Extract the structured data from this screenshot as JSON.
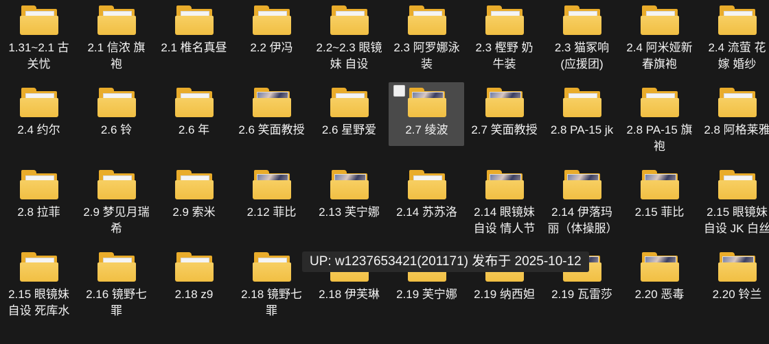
{
  "folders": [
    {
      "label": "1.31~2.1 古关忧",
      "thumb": false
    },
    {
      "label": "2.1 信浓 旗袍",
      "thumb": false
    },
    {
      "label": "2.1 椎名真昼",
      "thumb": false
    },
    {
      "label": "2.2 伊冯",
      "thumb": false
    },
    {
      "label": "2.2~2.3 眼镜妹 自设",
      "thumb": false
    },
    {
      "label": "2.3 阿罗娜泳装",
      "thumb": false
    },
    {
      "label": "2.3 樫野 奶牛装",
      "thumb": false
    },
    {
      "label": "2.3 猫冢响(应援团)",
      "thumb": false
    },
    {
      "label": "2.4 阿米娅新春旗袍",
      "thumb": false
    },
    {
      "label": "2.4 流萤 花嫁 婚纱",
      "thumb": false
    },
    {
      "label": "2.4 约尔",
      "thumb": false
    },
    {
      "label": "2.6 铃",
      "thumb": false
    },
    {
      "label": "2.6 年",
      "thumb": false
    },
    {
      "label": "2.6 笑面教授",
      "thumb": true
    },
    {
      "label": "2.6 星野爱",
      "thumb": false
    },
    {
      "label": "2.7 绫波",
      "thumb": true,
      "selected": true
    },
    {
      "label": "2.7 笑面教授",
      "thumb": true
    },
    {
      "label": "2.8 PA-15 jk",
      "thumb": false
    },
    {
      "label": "2.8 PA-15 旗袍",
      "thumb": false
    },
    {
      "label": "2.8 阿格莱雅",
      "thumb": false
    },
    {
      "label": "2.8 拉菲",
      "thumb": false
    },
    {
      "label": "2.9 梦见月瑞希",
      "thumb": false
    },
    {
      "label": "2.9 索米",
      "thumb": false
    },
    {
      "label": "2.12 菲比",
      "thumb": true
    },
    {
      "label": "2.13 芙宁娜",
      "thumb": true
    },
    {
      "label": "2.14 苏苏洛",
      "thumb": false
    },
    {
      "label": "2.14 眼镜妹 自设 情人节",
      "thumb": true
    },
    {
      "label": "2.14 伊落玛丽（体操服）",
      "thumb": true
    },
    {
      "label": "2.15 菲比",
      "thumb": true
    },
    {
      "label": "2.15 眼镜妹 自设 JK 白丝",
      "thumb": false
    },
    {
      "label": "2.15 眼镜妹 自设 死库水",
      "thumb": false
    },
    {
      "label": "2.16 镜野七罪",
      "thumb": false
    },
    {
      "label": "2.18 z9",
      "thumb": false
    },
    {
      "label": "2.18 镜野七罪",
      "thumb": false
    },
    {
      "label": "2.18 伊芙琳",
      "thumb": true
    },
    {
      "label": "2.19 芙宁娜",
      "thumb": true
    },
    {
      "label": "2.19 纳西妲",
      "thumb": true
    },
    {
      "label": "2.19 瓦雷莎",
      "thumb": true
    },
    {
      "label": "2.20 恶毒",
      "thumb": true
    },
    {
      "label": "2.20 铃兰",
      "thumb": true
    }
  ],
  "tooltip": "UP: w1237653421(201171) 发布于 2025-10-12",
  "colors": {
    "background": "#191919",
    "folder": "#f1bf43",
    "selection": "#4a4a4a"
  }
}
